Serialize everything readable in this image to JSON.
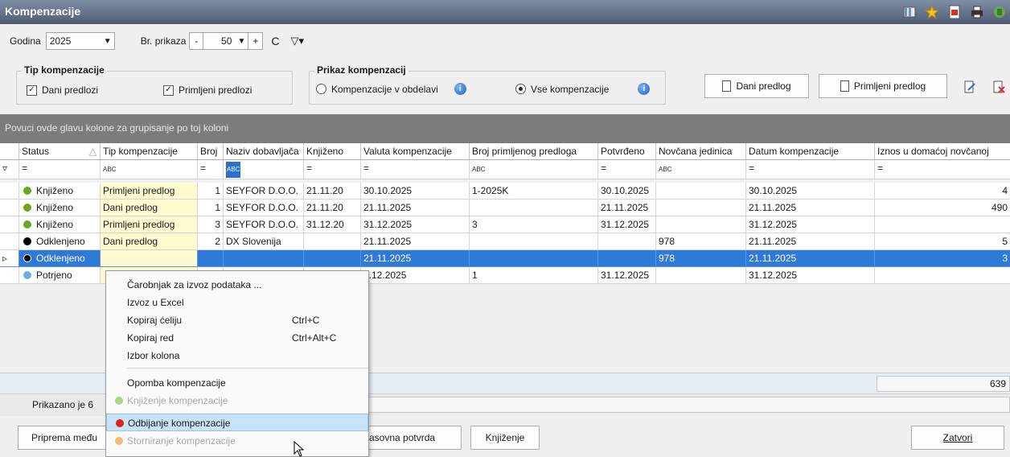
{
  "window": {
    "title": "Kompenzacije"
  },
  "toolbar": {
    "year_label": "Godina",
    "year_value": "2025",
    "count_label": "Br. prikaza",
    "count_minus": "-",
    "count_value": "50",
    "count_plus": "+",
    "refresh_glyph": "C",
    "filter_glyph": "▽▾"
  },
  "tip_group": {
    "title": "Tip kompenzacije",
    "dani": "Dani predlozi",
    "primljeni": "Primljeni predlozi"
  },
  "prikaz_group": {
    "title": "Prikaz kompenzacij",
    "option1": "Kompenzacije v obdelavi",
    "option2": "Vse kompenzacije",
    "selected": "Vse kompenzacije"
  },
  "actions": {
    "dani_predlog": "Dani predlog",
    "primljeni_predlog": "Primljeni predlog"
  },
  "group_panel_text": "Povuci ovde glavu kolone za grupisanje po toj koloni",
  "columns": [
    "Status",
    "Tip kompenzacije",
    "Broj",
    "Naziv dobavljača",
    "Knjiženo",
    "Valuta kompenzacije",
    "Broj primljenog predloga",
    "Potvrđeno",
    "Novčana jedinica",
    "Datum kompenzacije",
    "Iznos u domaćoj novčanoj"
  ],
  "filter_row": [
    "=",
    "ABC",
    "=",
    "ABC",
    "=",
    "=",
    "ABC",
    "=",
    "ABC",
    "=",
    "="
  ],
  "rows": [
    {
      "status": "Knjiženo",
      "status_color": "#6aa820",
      "tip": "Primljeni predlog",
      "broj": "1",
      "naziv": "SEYFOR D.O.O.",
      "knjizeno": "21.11.20",
      "valuta": "30.10.2025",
      "broj_predloga": "1-2025K",
      "potvrdeno": "30.10.2025",
      "jedinica": "",
      "datum": "30.10.2025",
      "iznos": "4"
    },
    {
      "status": "Knjiženo",
      "status_color": "#6aa820",
      "tip": "Dani predlog",
      "broj": "1",
      "naziv": "SEYFOR D.O.O.",
      "knjizeno": "21.11.20",
      "valuta": "21.11.2025",
      "broj_predloga": "",
      "potvrdeno": "21.11.2025",
      "jedinica": "",
      "datum": "21.11.2025",
      "iznos": "490"
    },
    {
      "status": "Knjiženo",
      "status_color": "#6aa820",
      "tip": "Primljeni predlog",
      "broj": "3",
      "naziv": "SEYFOR D.O.O.",
      "knjizeno": "31.12.20",
      "valuta": "31.12.2025",
      "broj_predloga": "3",
      "potvrdeno": "31.12.2025",
      "jedinica": "",
      "datum": "31.12.2025",
      "iznos": ""
    },
    {
      "status": "Odklenjeno",
      "status_color": "#000000",
      "tip": "Dani predlog",
      "broj": "2",
      "naziv": "DX Slovenija",
      "knjizeno": "",
      "valuta": "21.11.2025",
      "broj_predloga": "",
      "potvrdeno": "",
      "jedinica": "978",
      "datum": "21.11.2025",
      "iznos": "5"
    },
    {
      "status": "Odklenjeno",
      "status_color": "#000000",
      "tip": "",
      "broj": "",
      "naziv": "",
      "knjizeno": "",
      "valuta": "21.11.2025",
      "broj_predloga": "",
      "potvrdeno": "",
      "jedinica": "978",
      "datum": "21.11.2025",
      "iznos": "3"
    },
    {
      "status": "Potrjeno",
      "status_color": "#6ab0e0",
      "tip": "",
      "broj": "",
      "naziv": "",
      "knjizeno": "",
      "valuta": "1.12.2025",
      "broj_predloga": "1",
      "potvrdeno": "31.12.2025",
      "jedinica": "",
      "datum": "31.12.2025",
      "iznos": ""
    }
  ],
  "selected_row_index": 4,
  "sum_value": "639",
  "status_text": "Prikazano je 6",
  "bottom_buttons": {
    "priprema": "Priprema među",
    "potvrda": "asovna potvrda",
    "knjizenje": "Knjiženje",
    "zatvori": "Zatvori"
  },
  "context_menu": {
    "items": [
      {
        "label": "Čarobnjak za izvoz podataka ...",
        "shortcut": "",
        "disabled": false
      },
      {
        "label": "Izvoz u Excel",
        "shortcut": "",
        "disabled": false
      },
      {
        "label": "Kopiraj ćeliju",
        "shortcut": "Ctrl+C",
        "disabled": false
      },
      {
        "label": "Kopiraj red",
        "shortcut": "Ctrl+Alt+C",
        "disabled": false
      },
      {
        "label": "Izbor kolona",
        "shortcut": "",
        "disabled": false
      },
      {
        "label": "Opomba kompenzacije",
        "shortcut": "",
        "disabled": false
      },
      {
        "label": "Knjiženje kompenzacije",
        "shortcut": "",
        "disabled": true,
        "dot_color": "#8bc34a"
      },
      {
        "label": "Odbijanje kompenzacije",
        "shortcut": "",
        "disabled": false,
        "dot_color": "#e02020",
        "highlighted": true
      },
      {
        "label": "Storniranje kompenzacije",
        "shortcut": "",
        "disabled": true,
        "dot_color": "#f0a040"
      }
    ]
  }
}
